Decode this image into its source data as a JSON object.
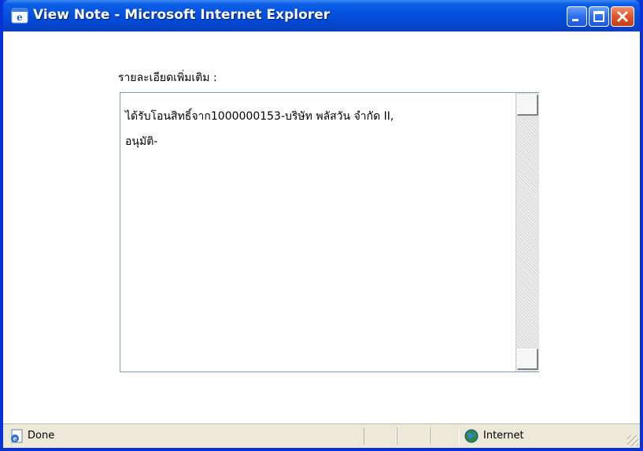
{
  "window": {
    "title": "View Note - Microsoft Internet Explorer"
  },
  "form": {
    "label": "รายละเอียดเพิ่มเติม :",
    "note_lines": [
      "ได้รับโอนสิทธิ์จาก1000000153-บริษัท พลัสวัน จำกัด II,",
      "อนุมัติ-"
    ]
  },
  "statusbar": {
    "status": "Done",
    "zone": "Internet"
  },
  "icons": {
    "title": "ie-icon",
    "status": "page-done-icon",
    "zone": "globe-icon"
  },
  "colors": {
    "titlebar": "#0553e0",
    "close_button": "#e2542a",
    "textarea_border": "#7f9db9",
    "statusbar": "#ece9d8"
  }
}
